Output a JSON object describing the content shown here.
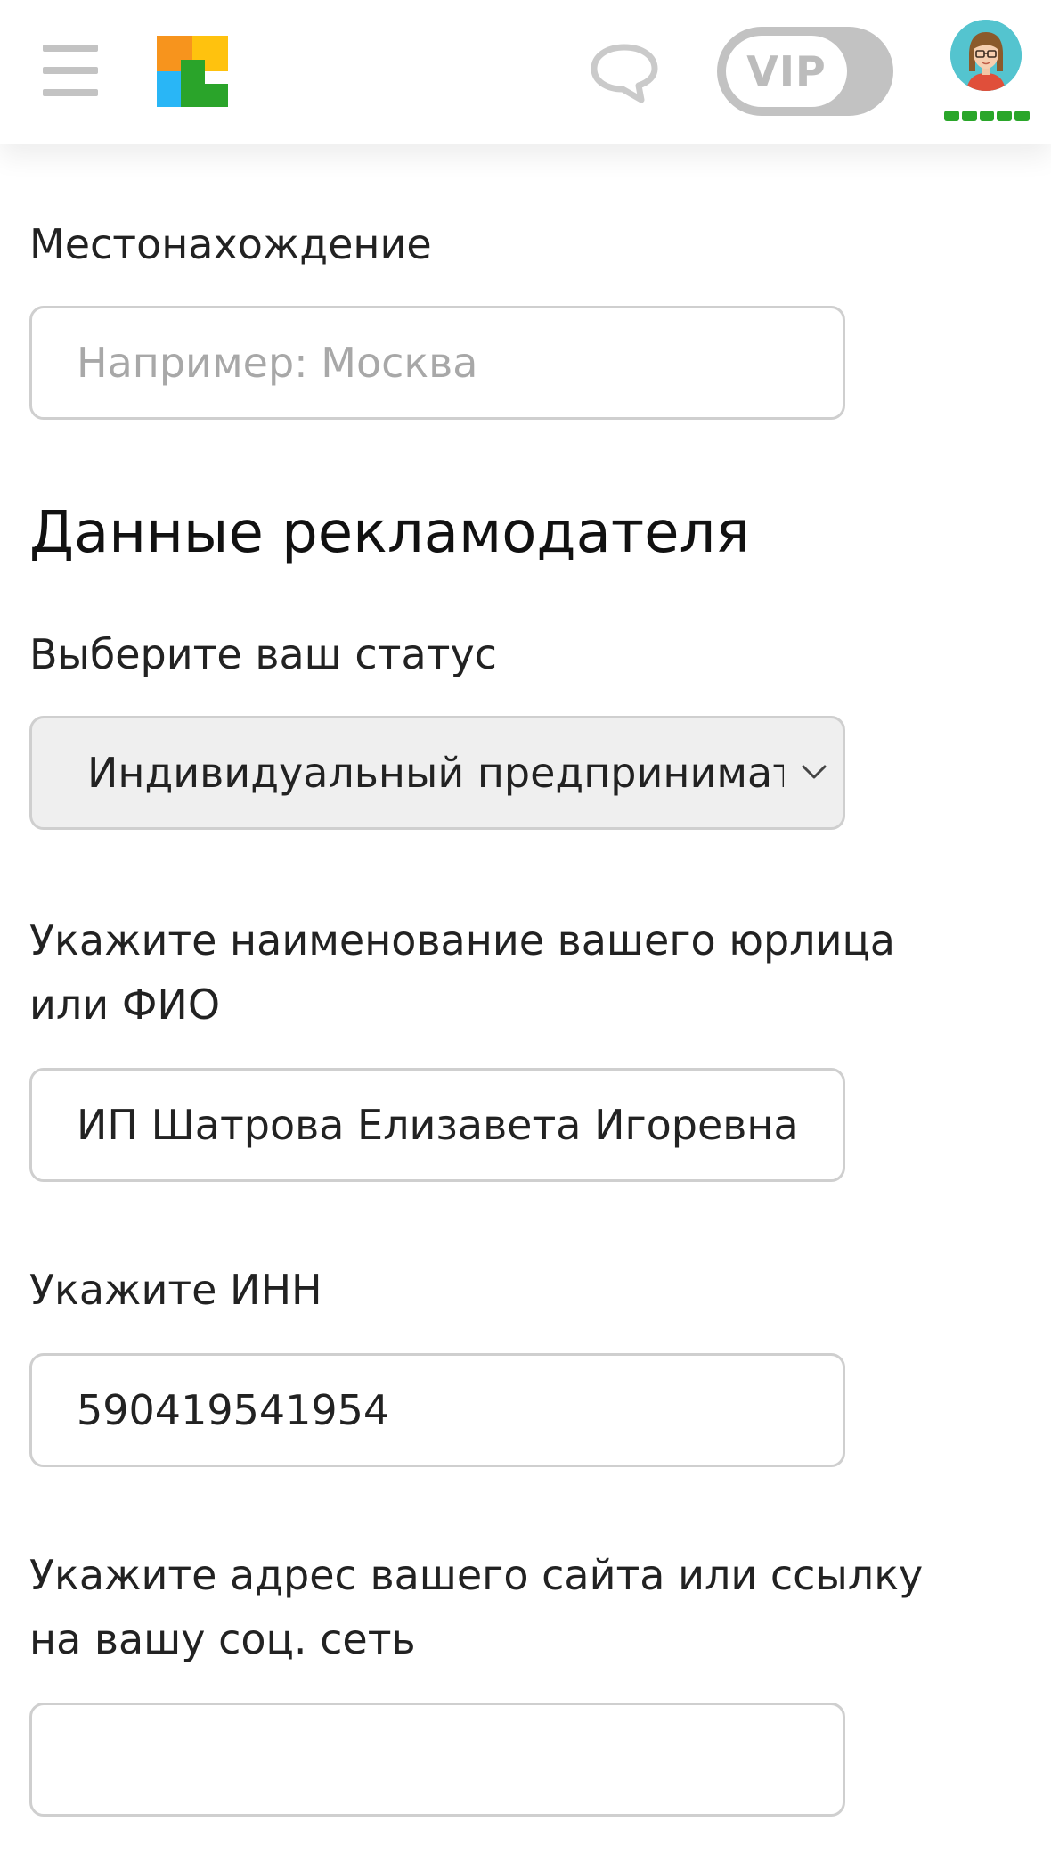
{
  "header": {
    "menu_icon": "hamburger-menu-icon",
    "logo_icon": "color-squares-logo",
    "chat_icon": "speech-bubble-icon",
    "vip_label": "VIP",
    "avatar_icon": "user-avatar",
    "rating_segments": 5,
    "colors": {
      "logo_orange": "#f7941d",
      "logo_green": "#2aa42a",
      "logo_yellow": "#ffc20e",
      "logo_blue": "#29b6f6",
      "rating_green": "#2aa62a",
      "toggle_gray": "#c2c2c2"
    }
  },
  "form": {
    "location": {
      "label": "Местонахождение",
      "placeholder": "Например: Москва",
      "value": ""
    },
    "section_title": "Данные рекламодателя",
    "status": {
      "label": "Выберите ваш статус",
      "selected": "Индивидуальный предприниматель",
      "chevron_icon": "chevron-down-icon"
    },
    "name": {
      "label_line1": "Укажите наименование вашего юрлица",
      "label_line2": "или ФИО",
      "value": "ИП Шатрова Елизавета Игоревна"
    },
    "inn": {
      "label": "Укажите ИНН",
      "value": "590419541954"
    },
    "website": {
      "label_line1": "Укажите адрес вашего сайта или ссылку",
      "label_line2": "на вашу соц. сеть",
      "value": ""
    }
  }
}
